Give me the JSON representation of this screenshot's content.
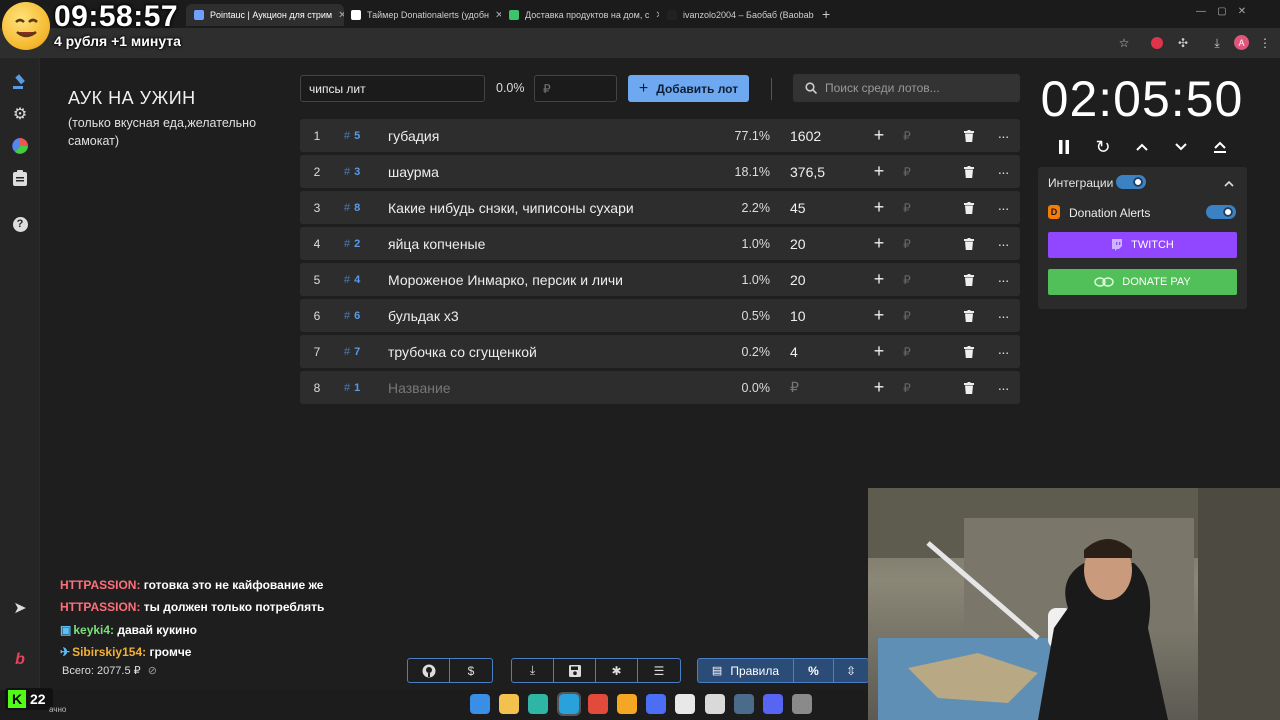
{
  "overlay": {
    "clock": "09:58:57",
    "subtitle": "4 рубля +1 минута"
  },
  "browser": {
    "tabs": [
      {
        "label": "Pointauc | Аукцион для стрим",
        "fav_color": "#6fa0ff"
      },
      {
        "label": "Таймер Donationalerts (удобн",
        "fav_color": "#ffffff"
      },
      {
        "label": "Доставка продуктов на дом, с",
        "fav_color": "#3cc46b"
      },
      {
        "label": "ivanzolo2004 – Баобаб (Baobab",
        "fav_color": "#222222"
      }
    ],
    "new_tab": "+"
  },
  "page": {
    "title": "АУК НА УЖИН",
    "subtitle": "(только вкусная еда,желательно самокат)"
  },
  "form": {
    "lot_name_value": "чипсы лит",
    "percent": "0.0%",
    "currency_placeholder": "₽",
    "add_button": "Добавить лот",
    "search_placeholder": "Поиск среди лотов..."
  },
  "lots": [
    {
      "idx": "1",
      "id": "5",
      "name": "губадия",
      "pct": "77.1%",
      "amount": "1602",
      "placeholder": false
    },
    {
      "idx": "2",
      "id": "3",
      "name": "шаурма",
      "pct": "18.1%",
      "amount": "376,5",
      "placeholder": false
    },
    {
      "idx": "3",
      "id": "8",
      "name": "Какие нибудь снэки, чиписоны сухари",
      "pct": "2.2%",
      "amount": "45",
      "placeholder": false
    },
    {
      "idx": "4",
      "id": "2",
      "name": "яйца копченые",
      "pct": "1.0%",
      "amount": "20",
      "placeholder": false
    },
    {
      "idx": "5",
      "id": "4",
      "name": "Мороженое Инмарко, персик и личи",
      "pct": "1.0%",
      "amount": "20",
      "placeholder": false
    },
    {
      "idx": "6",
      "id": "6",
      "name": "бульдак х3",
      "pct": "0.5%",
      "amount": "10",
      "placeholder": false
    },
    {
      "idx": "7",
      "id": "7",
      "name": "трубочка со сгущенкой",
      "pct": "0.2%",
      "amount": "4",
      "placeholder": false
    },
    {
      "idx": "8",
      "id": "1",
      "name": "Название",
      "pct": "0.0%",
      "amount": "₽",
      "placeholder": true
    }
  ],
  "lot_id_prefix": "#",
  "row_plus": "+",
  "row_currency": "₽",
  "row_more": "···",
  "timer": {
    "value": "02:05:50"
  },
  "integrations": {
    "header": "Интеграции",
    "donation_alerts": "Donation Alerts",
    "twitch": "TWITCH",
    "donatepay": "DONATE PAY"
  },
  "chat": [
    {
      "user": "HTTPASSION:",
      "text": " готовка это не кайфование же",
      "color": "#ff6f7a",
      "badge": ""
    },
    {
      "user": "HTTPASSION:",
      "text": " ты должен только потреблять",
      "color": "#ff6f7a",
      "badge": ""
    },
    {
      "user": "keyki4:",
      "text": " давай кукино",
      "color": "#7be07b",
      "badge": "▣"
    },
    {
      "user": "Sibirskiy154:",
      "text": " громче",
      "color": "#f2b134",
      "badge": "✈"
    }
  ],
  "total": "Всего: 2077.5 ₽",
  "toolbar": {
    "rules": "Правила",
    "percent": "%"
  },
  "kick": {
    "count": "22",
    "logo": "K",
    "label": "ачно"
  },
  "colors": {
    "accent": "#6ea8f0",
    "twitch": "#9146ff",
    "donatepay": "#52c058",
    "id_blue": "#5b9be6"
  }
}
